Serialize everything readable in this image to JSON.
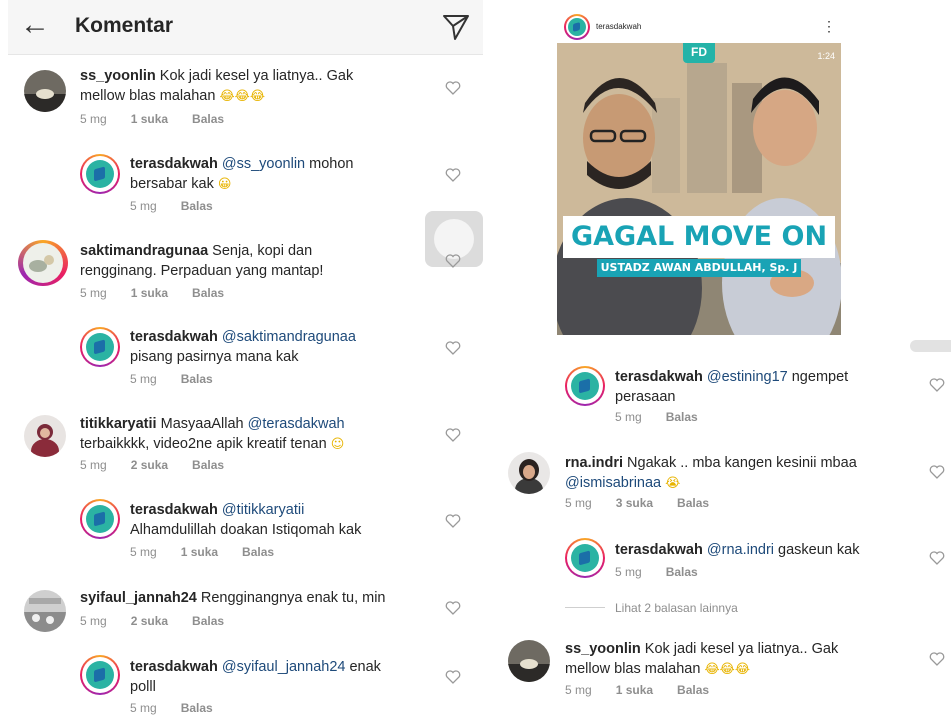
{
  "header": {
    "title": "Komentar"
  },
  "left_comments": [
    {
      "user": "ss_yoonlin",
      "text": "Kok jadi kesel ya liatnya.. Gak",
      "text2": "mellow blas malahan",
      "emoji": "😂😂😂",
      "time": "5 mg",
      "likes": "1 suka",
      "reply": "Balas"
    },
    {
      "user": "terasdakwah",
      "mention": "@ss_yoonlin",
      "text": " mohon",
      "text2": "bersabar kak",
      "emoji": "😀",
      "time": "5 mg",
      "reply": "Balas"
    },
    {
      "user": "saktimandragunaa",
      "text": "Senja, kopi dan",
      "text2": "rengginang. Perpaduan yang mantap!",
      "time": "5 mg",
      "likes": "1 suka",
      "reply": "Balas"
    },
    {
      "user": "terasdakwah",
      "mention": "@saktimandragunaa",
      "text2": "pisang pasirnya mana kak",
      "time": "5 mg",
      "reply": "Balas"
    },
    {
      "user": "titikkaryatii",
      "text": "MasyaaAllah",
      "mention": "@terasdakwah",
      "text2": "terbaikkkk, video2ne apik kreatif tenan",
      "emoji": "☺",
      "time": "5 mg",
      "likes": "2 suka",
      "reply": "Balas"
    },
    {
      "user": "terasdakwah",
      "mention": "@titikkaryatii",
      "text2": "Alhamdulillah doakan Istiqomah kak",
      "time": "5 mg",
      "likes": "1 suka",
      "reply": "Balas"
    },
    {
      "user": "syifaul_jannah24",
      "text": "Rengginangnya enak tu, min",
      "time": "5 mg",
      "likes": "2 suka",
      "reply": "Balas"
    },
    {
      "user": "terasdakwah",
      "mention": "@syifaul_jannah24",
      "text": " enak",
      "text2": "polll",
      "time": "5 mg",
      "reply": "Balas"
    }
  ],
  "post": {
    "account": "terasdakwah",
    "video_logo": "FD",
    "video_time": "1:24",
    "video_title": "GAGAL MOVE ON",
    "video_subtitle": "USTADZ AWAN ABDULLAH, Sp. J"
  },
  "right_comments": [
    {
      "user": "terasdakwah",
      "mention": "@estining17",
      "text": " ngempet",
      "text2": "perasaan",
      "time": "5 mg",
      "reply": "Balas"
    },
    {
      "user": "rna.indri",
      "text": "Ngakak .. mba kangen kesinii mbaa",
      "mention": "@ismisabrinaa",
      "emoji": "😭",
      "time": "5 mg",
      "likes": "3 suka",
      "reply": "Balas"
    },
    {
      "user": "terasdakwah",
      "mention": "@rna.indri",
      "text": " gaskeun kak",
      "time": "5 mg",
      "reply": "Balas"
    },
    {
      "user": "ss_yoonlin",
      "text": "Kok jadi kesel ya liatnya.. Gak",
      "text2": "mellow blas malahan",
      "emoji": "😂😂😂",
      "time": "5 mg",
      "likes": "1 suka",
      "reply": "Balas"
    }
  ],
  "view_replies": "Lihat 2 balasan lainnya",
  "colors": {
    "mention": "#1e4a7a",
    "meta": "#8e8e8e",
    "brand": "#2bb3a3",
    "video_accent": "#19a3b5"
  },
  "icons": {
    "back": "arrow-left-icon",
    "direct": "paper-plane-icon",
    "like": "heart-outline-icon",
    "more": "more-vertical-icon"
  }
}
